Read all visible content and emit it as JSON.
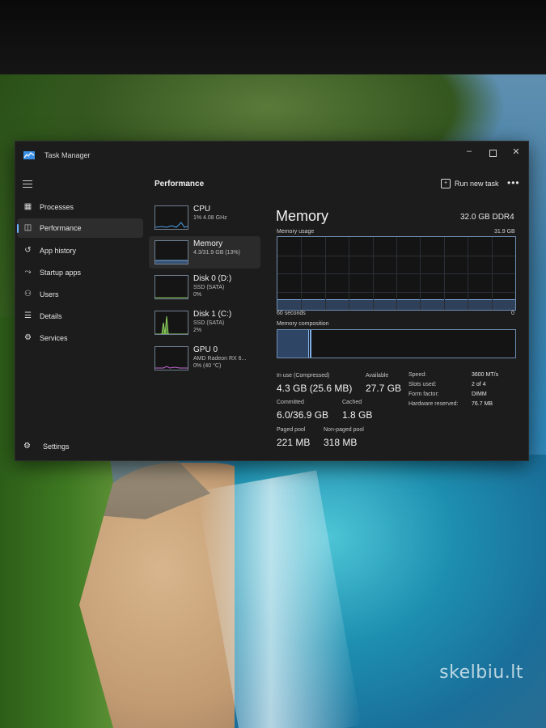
{
  "window": {
    "title": "Task Manager"
  },
  "sidebar": {
    "items": [
      {
        "label": "Processes",
        "icon": "processes-icon"
      },
      {
        "label": "Performance",
        "icon": "performance-icon",
        "active": true
      },
      {
        "label": "App history",
        "icon": "app-history-icon"
      },
      {
        "label": "Startup apps",
        "icon": "startup-apps-icon"
      },
      {
        "label": "Users",
        "icon": "users-icon"
      },
      {
        "label": "Details",
        "icon": "details-icon"
      },
      {
        "label": "Services",
        "icon": "services-icon"
      }
    ],
    "settings_label": "Settings"
  },
  "header": {
    "title": "Performance",
    "run_task_label": "Run new task",
    "more_label": "•••"
  },
  "resources": [
    {
      "name": "CPU",
      "sub1": "1% 4.08 GHz",
      "sub2": ""
    },
    {
      "name": "Memory",
      "sub1": "4.3/31.9 GB (13%)",
      "sub2": "",
      "active": true
    },
    {
      "name": "Disk 0 (D:)",
      "sub1": "SSD (SATA)",
      "sub2": "0%"
    },
    {
      "name": "Disk 1 (C:)",
      "sub1": "SSD (SATA)",
      "sub2": "2%"
    },
    {
      "name": "GPU 0",
      "sub1": "AMD Radeon RX 6...",
      "sub2": "0% (40 °C)"
    }
  ],
  "memory": {
    "title": "Memory",
    "total": "32.0 GB DDR4",
    "usage_label": "Memory usage",
    "usage_max": "31.9 GB",
    "time_left": "60 seconds",
    "time_right": "0",
    "composition_label": "Memory composition",
    "usage_fraction": 0.13,
    "stats": {
      "in_use_label": "In use (Compressed)",
      "in_use_value": "4.3 GB (25.6 MB)",
      "available_label": "Available",
      "available_value": "27.7 GB",
      "committed_label": "Committed",
      "committed_value": "6.0/36.9 GB",
      "cached_label": "Cached",
      "cached_value": "1.8 GB",
      "paged_label": "Paged pool",
      "paged_value": "221 MB",
      "nonpaged_label": "Non-paged pool",
      "nonpaged_value": "318 MB"
    },
    "details": [
      {
        "key": "Speed:",
        "value": "3600 MT/s"
      },
      {
        "key": "Slots used:",
        "value": "2 of 4"
      },
      {
        "key": "Form factor:",
        "value": "DIMM"
      },
      {
        "key": "Hardware reserved:",
        "value": "76.7 MB"
      }
    ]
  },
  "watermark": "skelbiu.lt"
}
